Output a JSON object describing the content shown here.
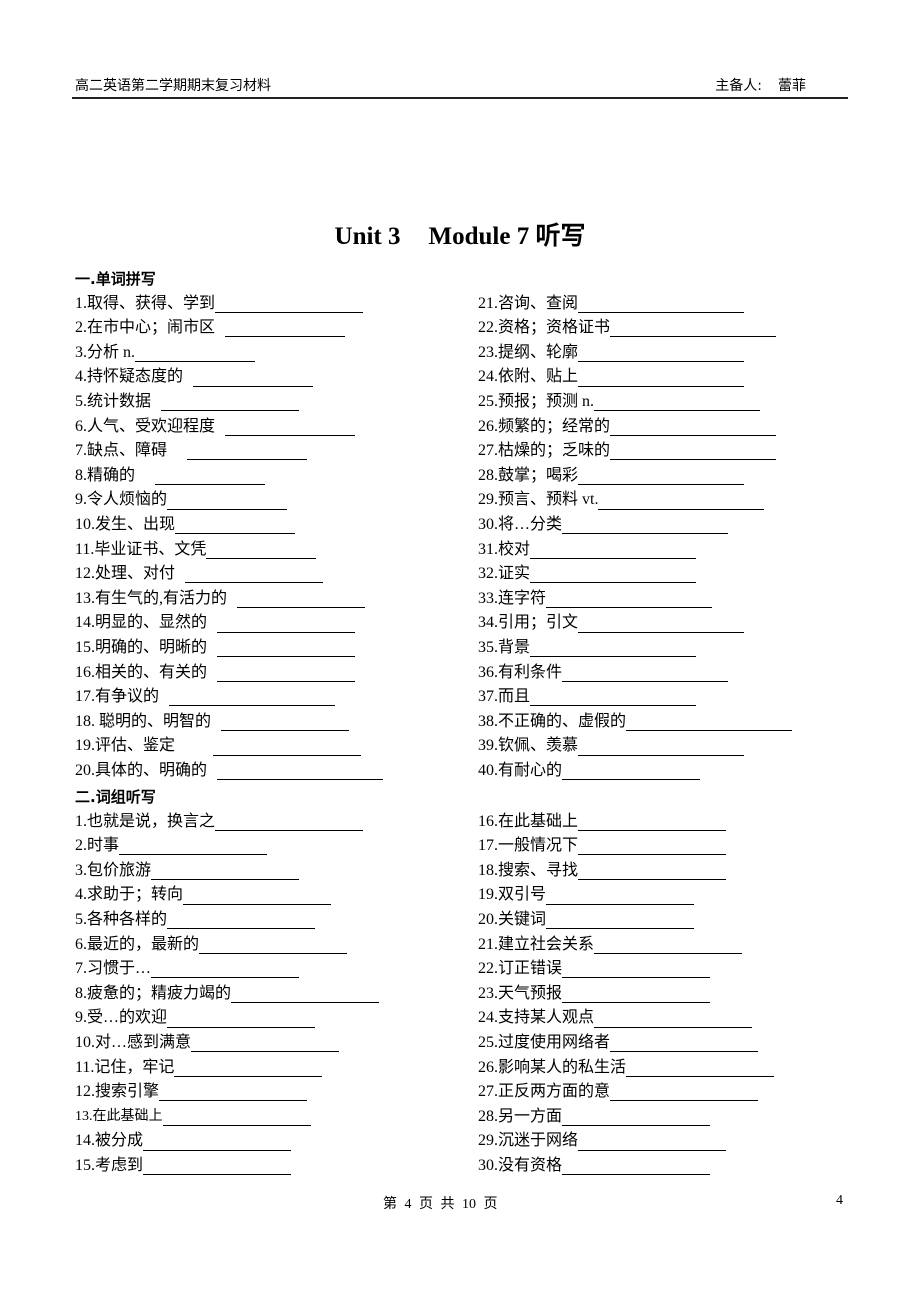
{
  "header": {
    "doc_title": "高二英语第二学期期末复习材料",
    "preparer_label": "主备人:",
    "preparer_name": "蕾菲"
  },
  "title": {
    "unit": "Unit 3",
    "module": "Module 7  听写"
  },
  "section1": {
    "heading": "一.单词拼写",
    "left": [
      {
        "label": "1.取得、获得、学到",
        "pad": 0,
        "blank": 148
      },
      {
        "label": "2.在市中心；闹市区",
        "pad": 10,
        "blank": 120
      },
      {
        "label": "3.分析 n.",
        "pad": 0,
        "blank": 120
      },
      {
        "label": "4.持怀疑态度的",
        "pad": 10,
        "blank": 120
      },
      {
        "label": "5.统计数据",
        "pad": 10,
        "blank": 138
      },
      {
        "label": "6.人气、受欢迎程度",
        "pad": 10,
        "blank": 130
      },
      {
        "label": "7.缺点、障碍",
        "pad": 20,
        "blank": 120
      },
      {
        "label": "8.精确的",
        "pad": 20,
        "blank": 110
      },
      {
        "label": "9.令人烦恼的",
        "pad": 0,
        "blank": 120
      },
      {
        "label": "10.发生、出现",
        "pad": 0,
        "blank": 120
      },
      {
        "label": "11.毕业证书、文凭",
        "pad": 0,
        "blank": 110
      },
      {
        "label": "12.处理、对付",
        "pad": 10,
        "blank": 138
      },
      {
        "label": "13.有生气的,有活力的",
        "pad": 10,
        "blank": 128
      },
      {
        "label": "14.明显的、显然的",
        "pad": 10,
        "blank": 138
      },
      {
        "label": "15.明确的、明晰的",
        "pad": 10,
        "blank": 138
      },
      {
        "label": "16.相关的、有关的",
        "pad": 10,
        "blank": 138
      },
      {
        "label": "17.有争议的",
        "pad": 10,
        "blank": 166
      },
      {
        "label": "18.  聪明的、明智的",
        "pad": 10,
        "blank": 128
      },
      {
        "label": "19.评估、鉴定",
        "pad": 38,
        "blank": 148
      },
      {
        "label": "20.具体的、明确的",
        "pad": 10,
        "blank": 166
      }
    ],
    "right": [
      {
        "label": "21.咨询、查阅",
        "pad": 0,
        "blank": 166
      },
      {
        "label": "22.资格；资格证书",
        "pad": 0,
        "blank": 166
      },
      {
        "label": "23.提纲、轮廓",
        "pad": 0,
        "blank": 166
      },
      {
        "label": "24.依附、贴上",
        "pad": 0,
        "blank": 166
      },
      {
        "label": "25.预报；预测 n.",
        "pad": 0,
        "blank": 166
      },
      {
        "label": "26.频繁的；经常的",
        "pad": 0,
        "blank": 166
      },
      {
        "label": "27.枯燥的；乏味的",
        "pad": 0,
        "blank": 166
      },
      {
        "label": "28.鼓掌；喝彩",
        "pad": 0,
        "blank": 166
      },
      {
        "label": "29.预言、预料 vt.",
        "pad": 0,
        "blank": 166
      },
      {
        "label": "30.将…分类",
        "pad": 0,
        "blank": 166
      },
      {
        "label": "31.校对",
        "pad": 0,
        "blank": 166
      },
      {
        "label": "32.证实",
        "pad": 0,
        "blank": 166
      },
      {
        "label": "33.连字符",
        "pad": 0,
        "blank": 166
      },
      {
        "label": "34.引用；引文",
        "pad": 0,
        "blank": 166
      },
      {
        "label": "35.背景",
        "pad": 0,
        "blank": 166
      },
      {
        "label": "36.有利条件",
        "pad": 0,
        "blank": 166
      },
      {
        "label": "37.而且",
        "pad": 0,
        "blank": 166
      },
      {
        "label": "38.不正确的、虚假的",
        "pad": 0,
        "blank": 166
      },
      {
        "label": "39.钦佩、羡慕",
        "pad": 0,
        "blank": 166
      },
      {
        "label": "40.有耐心的",
        "pad": 0,
        "blank": 138
      }
    ]
  },
  "section2": {
    "heading": "二.词组听写",
    "left": [
      {
        "label": "1.也就是说，换言之",
        "pad": 0,
        "blank": 148
      },
      {
        "label": "2.时事",
        "pad": 0,
        "blank": 148
      },
      {
        "label": "3.包价旅游",
        "pad": 0,
        "blank": 148
      },
      {
        "label": "4.求助于；转向",
        "pad": 0,
        "blank": 148
      },
      {
        "label": "5.各种各样的",
        "pad": 0,
        "blank": 148
      },
      {
        "label": "6.最近的，最新的",
        "pad": 0,
        "blank": 148
      },
      {
        "label": "7.习惯于…",
        "pad": 0,
        "blank": 148
      },
      {
        "label": "8.疲惫的；精疲力竭的",
        "pad": 0,
        "blank": 148
      },
      {
        "label": "9.受…的欢迎",
        "pad": 0,
        "blank": 148
      },
      {
        "label": "10.对…感到满意",
        "pad": 0,
        "blank": 148
      },
      {
        "label": "11.记住，牢记",
        "pad": 0,
        "blank": 148
      },
      {
        "label": "12.搜索引擎",
        "pad": 0,
        "blank": 148
      },
      {
        "label": "13.在此基础上",
        "pad": 0,
        "blank": 148,
        "small": true
      },
      {
        "label": "14.被分成",
        "pad": 0,
        "blank": 148
      },
      {
        "label": "15.考虑到",
        "pad": 0,
        "blank": 148
      }
    ],
    "right": [
      {
        "label": "16.在此基础上",
        "pad": 0,
        "blank": 148
      },
      {
        "label": "17.一般情况下",
        "pad": 0,
        "blank": 148
      },
      {
        "label": "18.搜索、寻找",
        "pad": 0,
        "blank": 148
      },
      {
        "label": "19.双引号",
        "pad": 0,
        "blank": 148
      },
      {
        "label": "20.关键词",
        "pad": 0,
        "blank": 148
      },
      {
        "label": "21.建立社会关系",
        "pad": 0,
        "blank": 148
      },
      {
        "label": "22.订正错误",
        "pad": 0,
        "blank": 148
      },
      {
        "label": "23.天气预报",
        "pad": 0,
        "blank": 148
      },
      {
        "label": "24.支持某人观点",
        "pad": 0,
        "blank": 158
      },
      {
        "label": "25.过度使用网络者",
        "pad": 0,
        "blank": 148
      },
      {
        "label": "26.影响某人的私生活",
        "pad": 0,
        "blank": 148
      },
      {
        "label": "27.正反两方面的意",
        "pad": 0,
        "blank": 148
      },
      {
        "label": "28.另一方面",
        "pad": 0,
        "blank": 148
      },
      {
        "label": "29.沉迷于网络",
        "pad": 0,
        "blank": 148
      },
      {
        "label": "30.没有资格",
        "pad": 0,
        "blank": 148
      }
    ]
  },
  "footer": {
    "page_text": "第 4 页 共 10 页",
    "page_number": "4"
  }
}
